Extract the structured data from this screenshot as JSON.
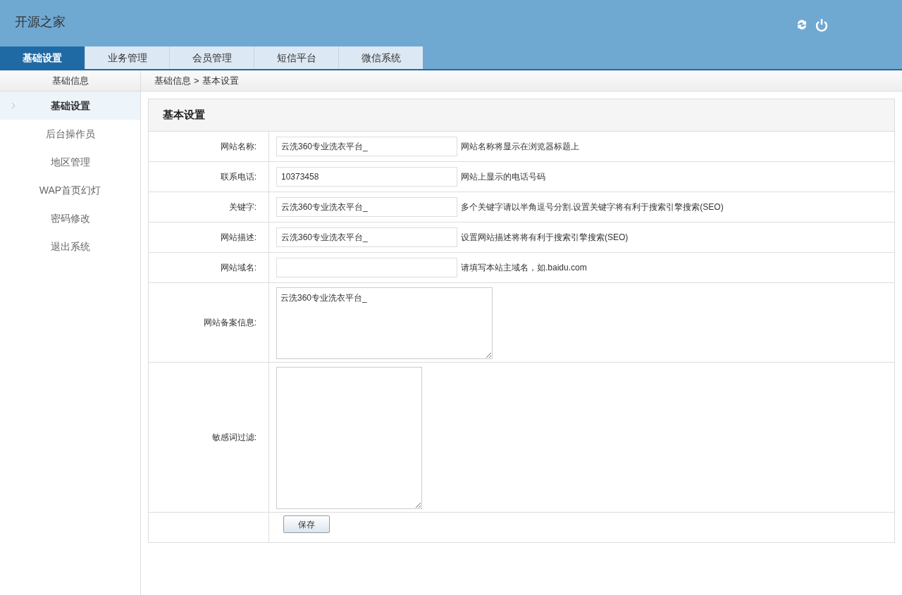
{
  "header": {
    "title": "开源之家"
  },
  "tabs": [
    {
      "label": "基础设置",
      "selected": true
    },
    {
      "label": "业务管理",
      "selected": false
    },
    {
      "label": "会员管理",
      "selected": false
    },
    {
      "label": "短信平台",
      "selected": false
    },
    {
      "label": "微信系统",
      "selected": false
    }
  ],
  "sidebar": {
    "heading": "基础信息",
    "items": [
      {
        "label": "基础设置",
        "selected": true
      },
      {
        "label": "后台操作员",
        "selected": false
      },
      {
        "label": "地区管理",
        "selected": false
      },
      {
        "label": "WAP首页幻灯",
        "selected": false
      },
      {
        "label": "密码修改",
        "selected": false
      },
      {
        "label": "退出系统",
        "selected": false
      }
    ]
  },
  "breadcrumb": {
    "parent": "基础信息",
    "separator": ">",
    "current": "基本设置"
  },
  "form": {
    "title": "基本设置",
    "rows": [
      {
        "kind": "input",
        "label": "网站名称:",
        "value": "云洗360专业洗衣平台_",
        "hint": "网站名称将显示在浏览器标题上"
      },
      {
        "kind": "input",
        "label": "联系电话:",
        "value": "10373458",
        "hint": "网站上显示的电话号码"
      },
      {
        "kind": "input",
        "label": "关键字:",
        "value": "云洗360专业洗衣平台_",
        "hint": "多个关键字请以半角逗号分割.设置关键字将有利于搜索引擎搜索(SEO)"
      },
      {
        "kind": "input",
        "label": "网站描述:",
        "value": "云洗360专业洗衣平台_",
        "hint": "设置网站描述将将有利于搜索引擎搜索(SEO)"
      },
      {
        "kind": "input",
        "label": "网站域名:",
        "hint": "请填写本站主域名，如.baidu.com"
      },
      {
        "kind": "textarea",
        "label": "网站备案信息:",
        "value": "云洗360专业洗衣平台_"
      },
      {
        "kind": "textarea_tall",
        "label": "敏感词过滤:"
      }
    ],
    "save_button": "保存"
  }
}
